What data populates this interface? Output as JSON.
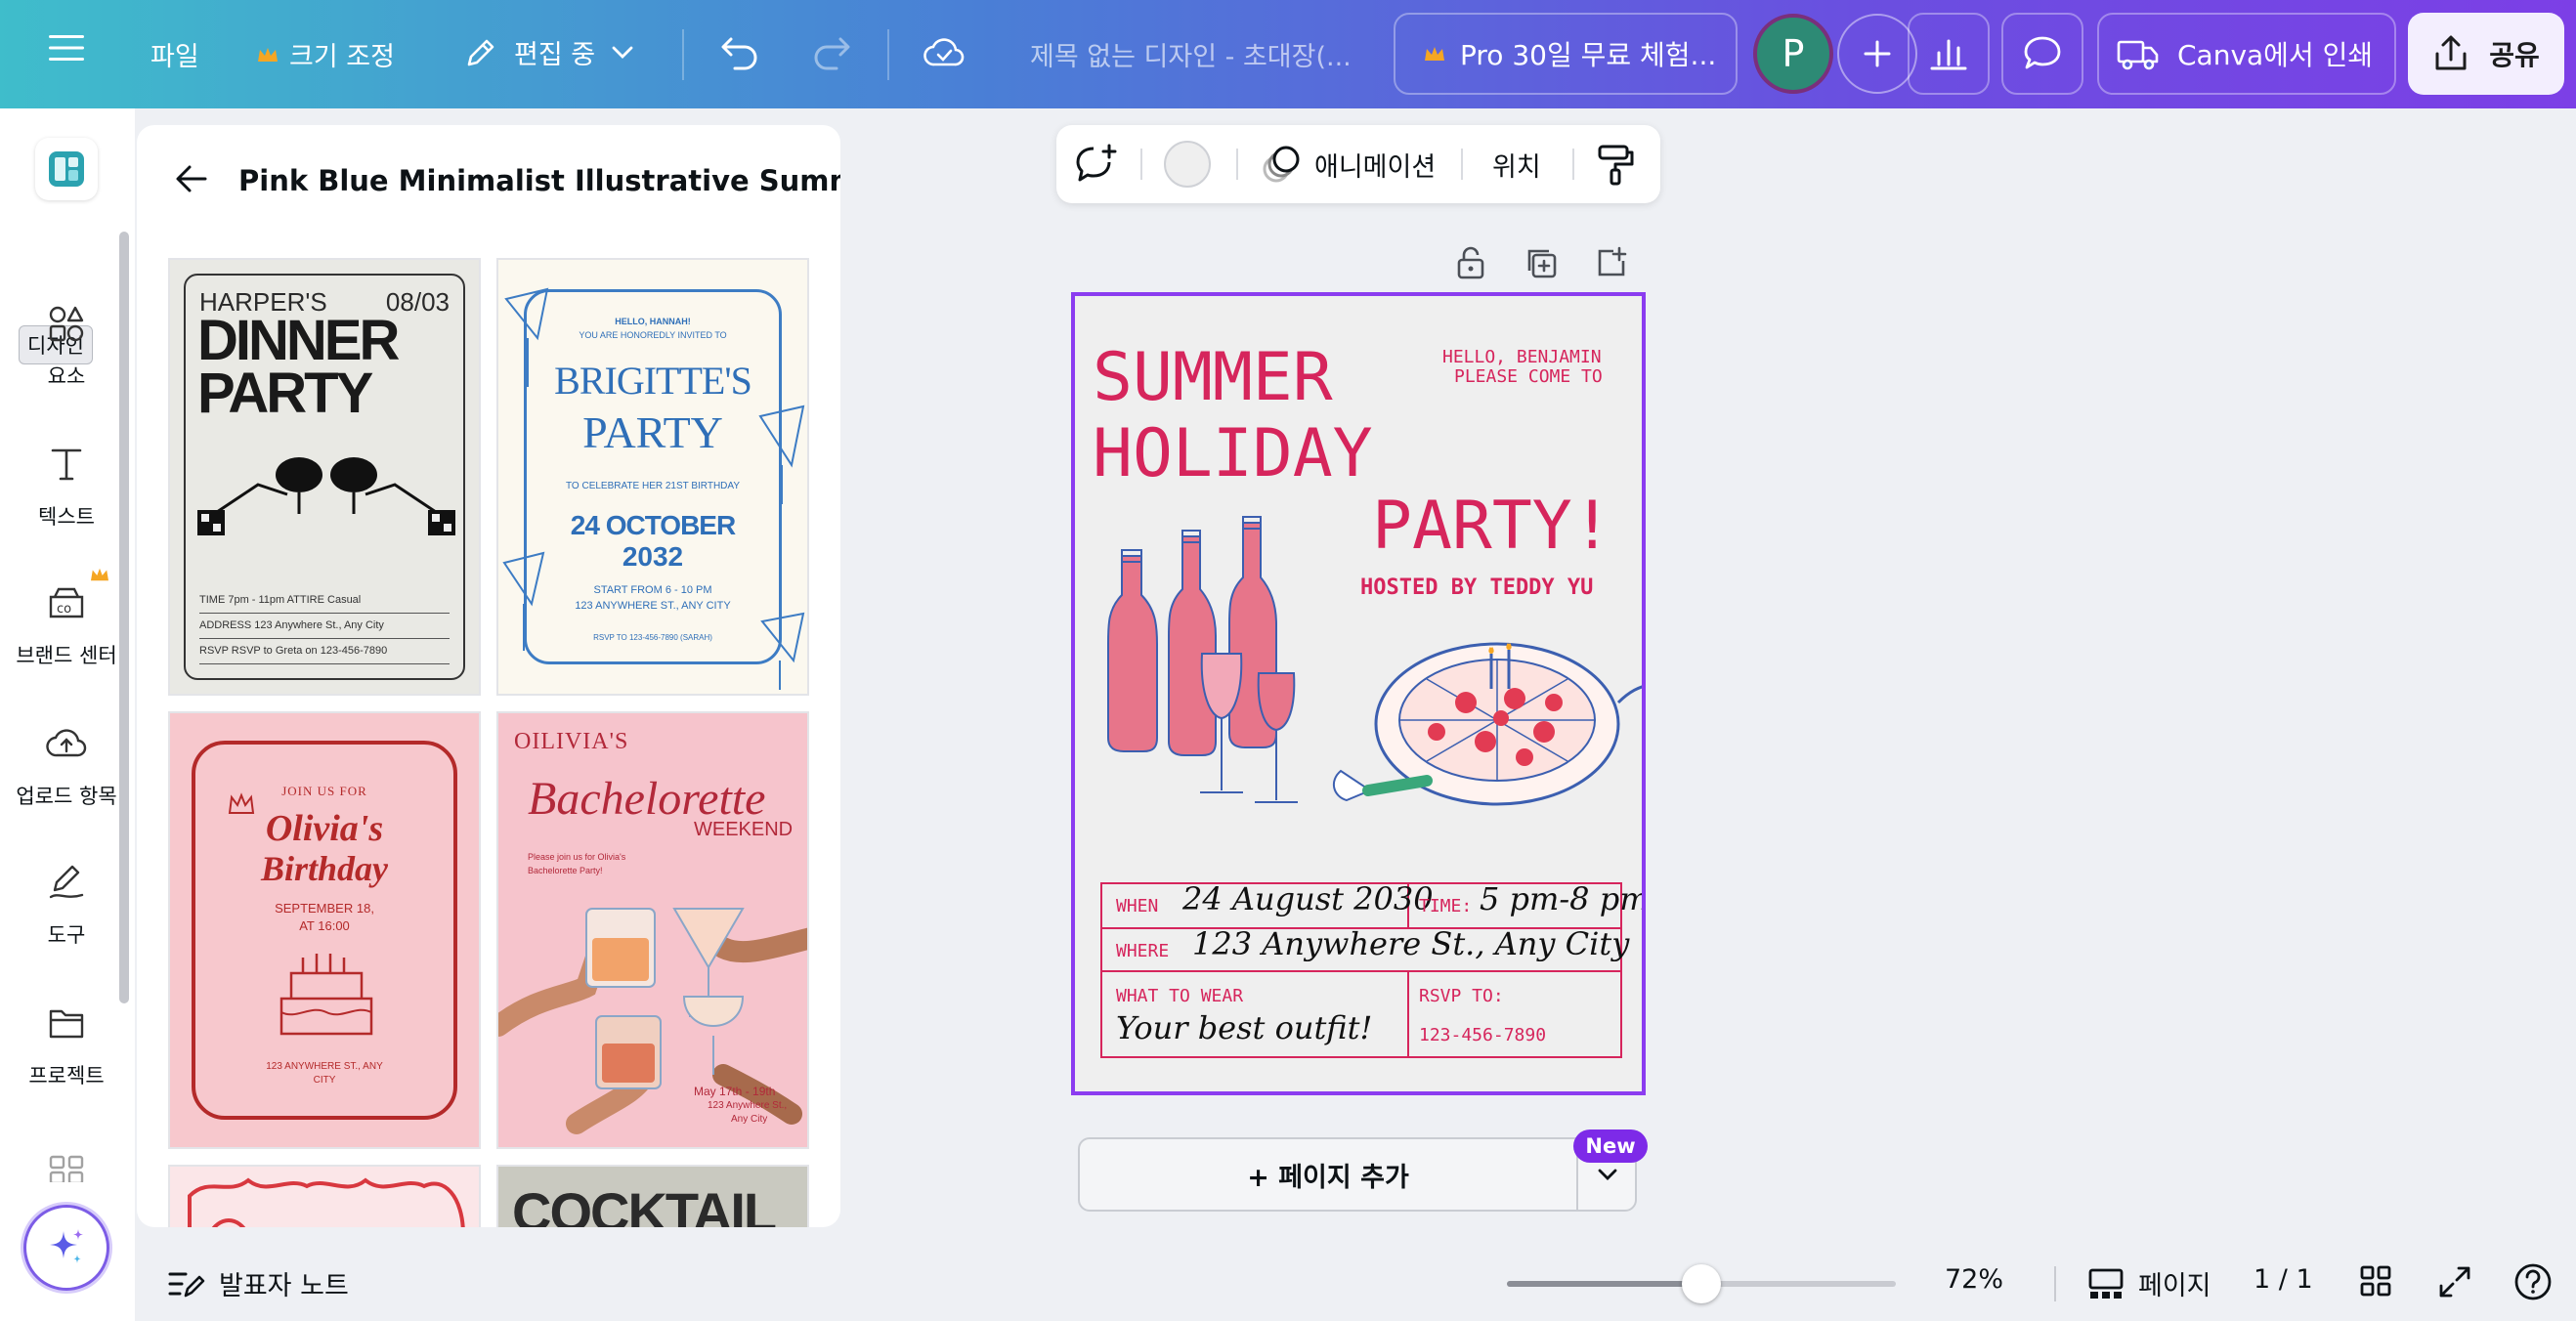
{
  "topbar": {
    "file_label": "파일",
    "resize_label": "크기 조정",
    "editing_label": "편집 중",
    "doc_title": "제목 없는 디자인 - 초대장(...",
    "pro_trial_label": "Pro 30일 무료 체험...",
    "avatar_initial": "P",
    "print_label": "Canva에서 인쇄",
    "share_label": "공유"
  },
  "rail": {
    "tooltip": "디자인",
    "items": [
      {
        "label": "요소",
        "icon": "elements-icon"
      },
      {
        "label": "텍스트",
        "icon": "text-icon"
      },
      {
        "label": "브랜드 센터",
        "icon": "brand-icon"
      },
      {
        "label": "업로드 항목",
        "icon": "upload-cloud-icon"
      },
      {
        "label": "도구",
        "icon": "tools-pen-icon"
      },
      {
        "label": "프로젝트",
        "icon": "folder-icon"
      }
    ]
  },
  "panel": {
    "title": "Pink Blue Minimalist Illustrative Summe...",
    "templates": [
      {
        "name_left": "HARPER'S",
        "date": "08/03",
        "line1": "DINNER",
        "line2": "PARTY",
        "rows": [
          "TIME   7pm - 11pm     ATTIRE   Casual",
          "ADDRESS   123 Anywhere St., Any City",
          "RSVP   RSVP to Greta on 123-456-7890"
        ]
      },
      {
        "hello": "HELLO, HANNAH!",
        "invited": "YOU ARE HONOREDLY INVITED TO",
        "line1": "BRIGITTE'S",
        "line2": "PARTY",
        "celebrate": "TO CELEBRATE HER 21ST BIRTHDAY",
        "date1": "24 OCTOBER",
        "date2": "2032",
        "start": "START FROM 6 - 10 PM",
        "address": "123 ANYWHERE ST., ANY CITY",
        "rsvp": "RSVP TO 123-456-7890 (SARAH)"
      },
      {
        "join": "JOIN US FOR",
        "name": "Olivia's",
        "event": "Birthday",
        "date": "SEPTEMBER 18,",
        "time": "AT 16:00",
        "address1": "123 ANYWHERE ST., ANY",
        "address2": "CITY"
      },
      {
        "name": "OILIVIA'S",
        "title": "Bachelorette",
        "subtitle": "WEEKEND",
        "blurb1": "Please join us for Olivia's",
        "blurb2": "Bachelorette Party!",
        "dates": "May 17th - 19th",
        "address1": "123 Anywhere St.,",
        "address2": "Any City"
      },
      {
        "title": ""
      },
      {
        "title": "COCKTAIL"
      }
    ]
  },
  "context_toolbar": {
    "animation_label": "애니메이션",
    "position_label": "위치"
  },
  "design": {
    "greeting1": "HELLO, BENJAMIN",
    "greeting2": "PLEASE COME TO",
    "title1": "SUMMER",
    "title2": "HOLIDAY",
    "title3": "PARTY!",
    "host": "HOSTED BY TEDDY YU",
    "when_label": "WHEN",
    "when_value": "24 August 2030",
    "time_label": "TIME:",
    "time_value": "5 pm-8 pm",
    "where_label": "WHERE",
    "where_value": "123 Anywhere St., Any City",
    "wear_label": "WHAT TO WEAR",
    "wear_value": "Your best outfit!",
    "rsvp_label": "RSVP TO:",
    "rsvp_value": "123-456-7890",
    "accent_color": "#d6255c"
  },
  "add_page": {
    "label": "+ 페이지 추가",
    "badge": "New"
  },
  "bottombar": {
    "notes_label": "발표자 노트",
    "zoom": "72%",
    "zoom_fraction": 0.5,
    "pages_label": "페이지",
    "page_count": "1 / 1"
  },
  "colors": {
    "selection_border": "#8b3cf0",
    "new_badge": "#7d2ae8",
    "crown": "#f5a623"
  }
}
